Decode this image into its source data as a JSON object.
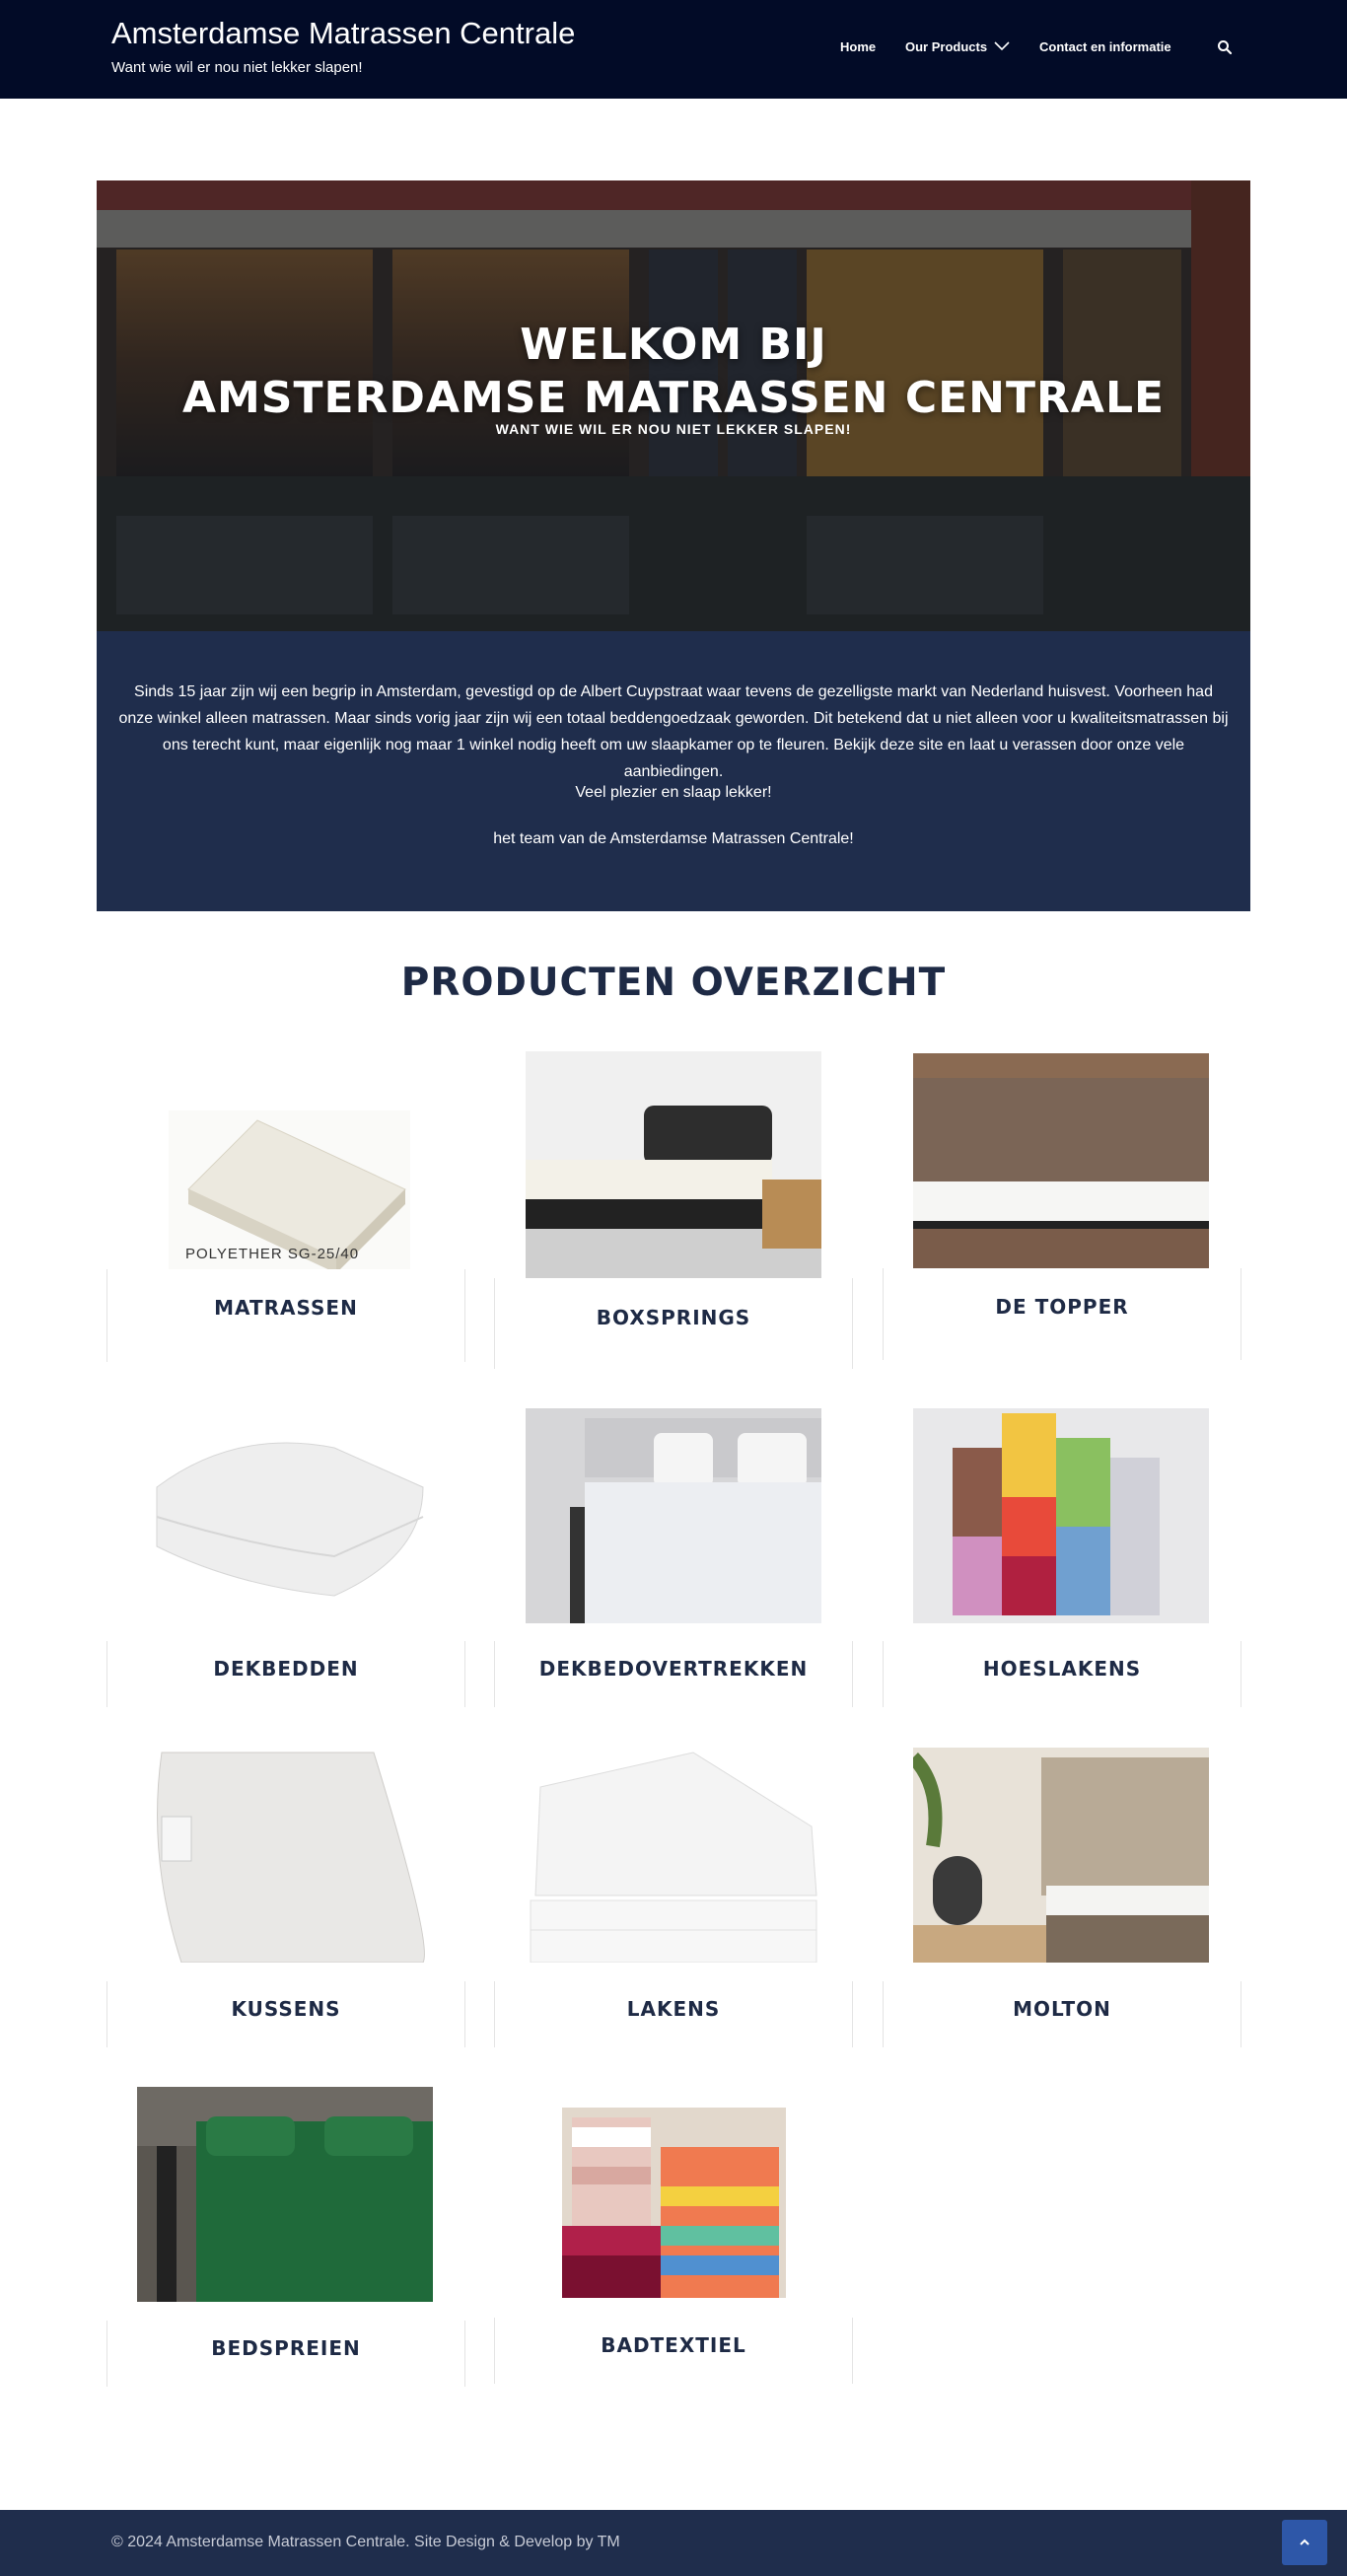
{
  "header": {
    "site_title": "Amsterdamse Matrassen Centrale",
    "tagline": "Want wie wil er nou niet lekker slapen!",
    "nav": {
      "home": "Home",
      "products": "Our Products",
      "contact": "Contact en informatie"
    },
    "search_icon": "search-icon"
  },
  "hero": {
    "title_line1": "WELKOM BIJ",
    "title_line2": "AMSTERDAMSE MATRASSEN CENTRALE",
    "subtitle": "WANT WIE WIL ER NOU NIET LEKKER SLAPEN!"
  },
  "intro": {
    "paragraph1": "Sinds 15 jaar zijn wij een begrip in Amsterdam, gevestigd op de Albert Cuypstraat waar tevens de gezelligste markt van Nederland huisvest. Voorheen had onze winkel alleen matrassen. Maar sinds vorig jaar zijn wij een totaal beddengoedzaak geworden. Dit betekend dat u niet alleen voor u kwaliteitsmatrassen bij ons terecht kunt, maar eigenlijk nog maar 1 winkel nodig heeft om uw slaapkamer op te fleuren. Bekijk deze site en laat u verassen door onze vele aanbiedingen.",
    "paragraph2": "Veel plezier en slaap lekker!",
    "paragraph3": "het team van de Amsterdamse Matrassen Centrale!"
  },
  "products": {
    "title": "PRODUCTEN OVERZICHT",
    "items": [
      {
        "label": "MATRASSEN",
        "image_caption": "POLYETHER SG-25/40"
      },
      {
        "label": "BOXSPRINGS"
      },
      {
        "label": "DE TOPPER"
      },
      {
        "label": "DEKBEDDEN"
      },
      {
        "label": "DEKBEDOVERTREKKEN"
      },
      {
        "label": "HOESLAKENS"
      },
      {
        "label": "KUSSENS"
      },
      {
        "label": "LAKENS"
      },
      {
        "label": "MOLTON"
      },
      {
        "label": "BEDSPREIEN"
      },
      {
        "label": "BADTEXTIEL"
      }
    ]
  },
  "footer": {
    "copyright": "© 2024 Amsterdamse Matrassen Centrale. Site Design & Develop by TM"
  },
  "colors": {
    "header_bg": "#020b27",
    "navy": "#1f2d4c",
    "heading_text": "#1e2a45",
    "back_to_top": "#2e57a8"
  }
}
